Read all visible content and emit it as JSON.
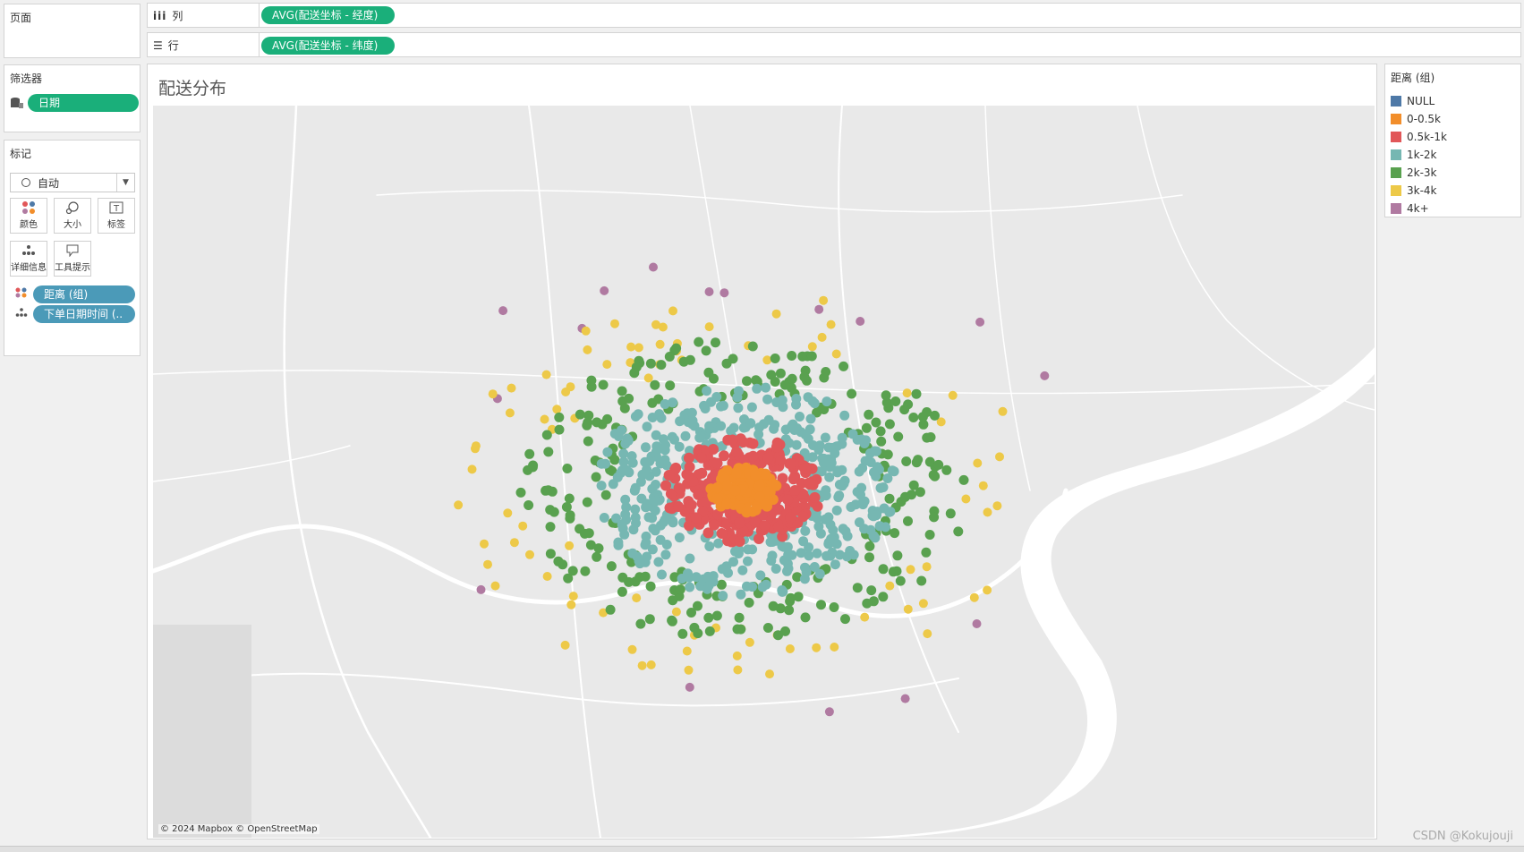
{
  "pages_panel": {
    "title": "页面"
  },
  "columns_shelf": {
    "label": "列",
    "pill": "AVG(配送坐标 - 经度)"
  },
  "rows_shelf": {
    "label": "行",
    "pill": "AVG(配送坐标 - 纬度)"
  },
  "filters_panel": {
    "title": "筛选器",
    "pill": "日期"
  },
  "marks_panel": {
    "title": "标记",
    "mark_type": "自动",
    "buttons": {
      "color": "颜色",
      "size": "大小",
      "label": "标签",
      "detail": "详细信息",
      "tooltip": "工具提示"
    },
    "fields": [
      "距离 (组)",
      "下单日期时间 (.."
    ]
  },
  "sheet": {
    "title": "配送分布",
    "attribution": "© 2024 Mapbox © OpenStreetMap"
  },
  "legend": {
    "title": "距离 (组)",
    "items": [
      {
        "label": "NULL",
        "color": "#4e79a7"
      },
      {
        "label": "0-0.5k",
        "color": "#f28e2b"
      },
      {
        "label": "0.5k-1k",
        "color": "#e15759"
      },
      {
        "label": "1k-2k",
        "color": "#76b7b2"
      },
      {
        "label": "2k-3k",
        "color": "#59a14f"
      },
      {
        "label": "3k-4k",
        "color": "#edc948"
      },
      {
        "label": "4k+",
        "color": "#b07aa1"
      }
    ]
  },
  "watermark": "CSDN @Kokujouji"
}
